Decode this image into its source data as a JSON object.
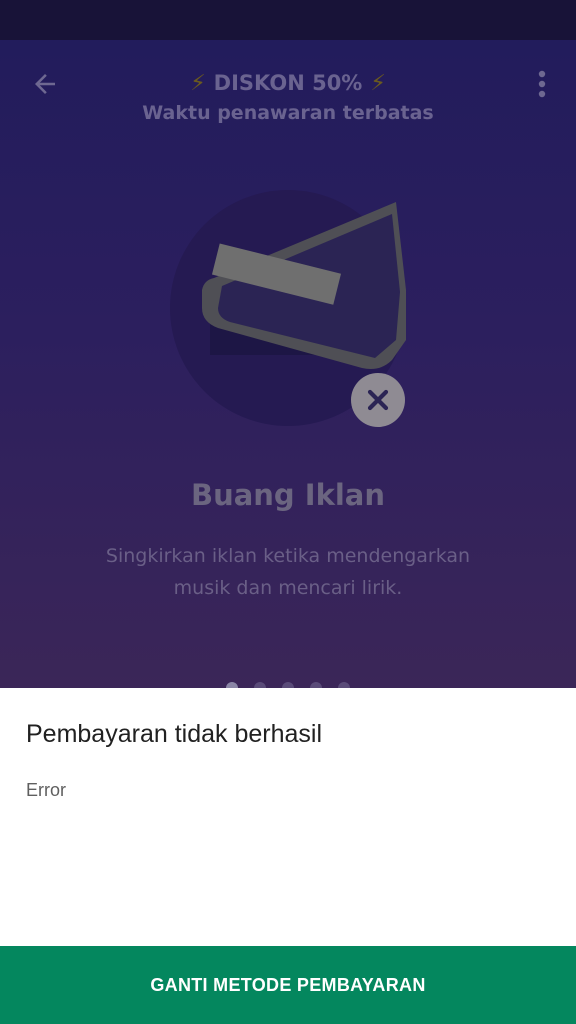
{
  "header": {
    "bolt_left": "⚡",
    "bolt_right": "⚡",
    "promo_title": "DISKON 50%",
    "promo_subtitle": "Waktu penawaran terbatas",
    "back_icon": "arrow-left-icon",
    "menu_icon": "more-vertical-icon"
  },
  "feature": {
    "title": "Buang Iklan",
    "description": "Singkirkan iklan ketika mendengarkan musik dan mencari lirik.",
    "badge_icon": "close-icon"
  },
  "carousel": {
    "page_count": 5,
    "active_index": 0
  },
  "dialog": {
    "title": "Pembayaran tidak berhasil",
    "message": "Error",
    "action_label": "GANTI METODE PEMBAYARAN"
  },
  "colors": {
    "accent_green": "#04875e",
    "background_top": "#221c5c",
    "background_bottom": "#3b2658"
  }
}
